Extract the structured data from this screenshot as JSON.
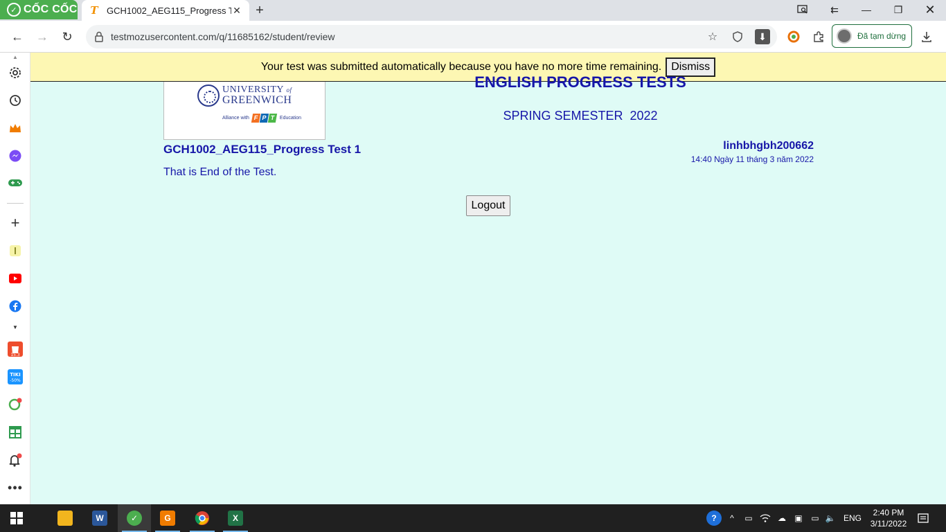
{
  "browser": {
    "brand_name": "CỐC CỐC",
    "tab_title": "GCH1002_AEG115_Progress T",
    "url": "testmozusercontent.com/q/11685162/student/review",
    "profile_label": "Đã tạm dừng"
  },
  "notice": {
    "message": "Your test was submitted automatically because you have no more time remaining.",
    "dismiss_label": "Dismiss"
  },
  "logo": {
    "university_line1": "UNIVERSITY",
    "university_of": "of",
    "university_line2": "GREENWICH",
    "alliance_with": "Alliance with",
    "fpt_letters": [
      "F",
      "P",
      "T"
    ],
    "fpt_colors": [
      "#f37021",
      "#0f69b4",
      "#4cb848"
    ],
    "education": "Education"
  },
  "page": {
    "title": "ENGLISH PROGRESS TESTS",
    "semester": "SPRING SEMESTER  2022",
    "test_name": "GCH1002_AEG115_Progress Test 1",
    "end_text": "That is End of the Test.",
    "username": "linhbhgbh200662",
    "timestamp": "14:40 Ngày 11 tháng 3 năm 2022",
    "logout_label": "Logout"
  },
  "taskbar": {
    "lang": "ENG",
    "time": "2:40 PM",
    "date": "3/11/2022"
  },
  "colors": {
    "page_bg": "#dffbf6",
    "text_blue": "#1616a8",
    "notice_bg": "#fdf7b3",
    "brand_green": "#4cae4f"
  }
}
